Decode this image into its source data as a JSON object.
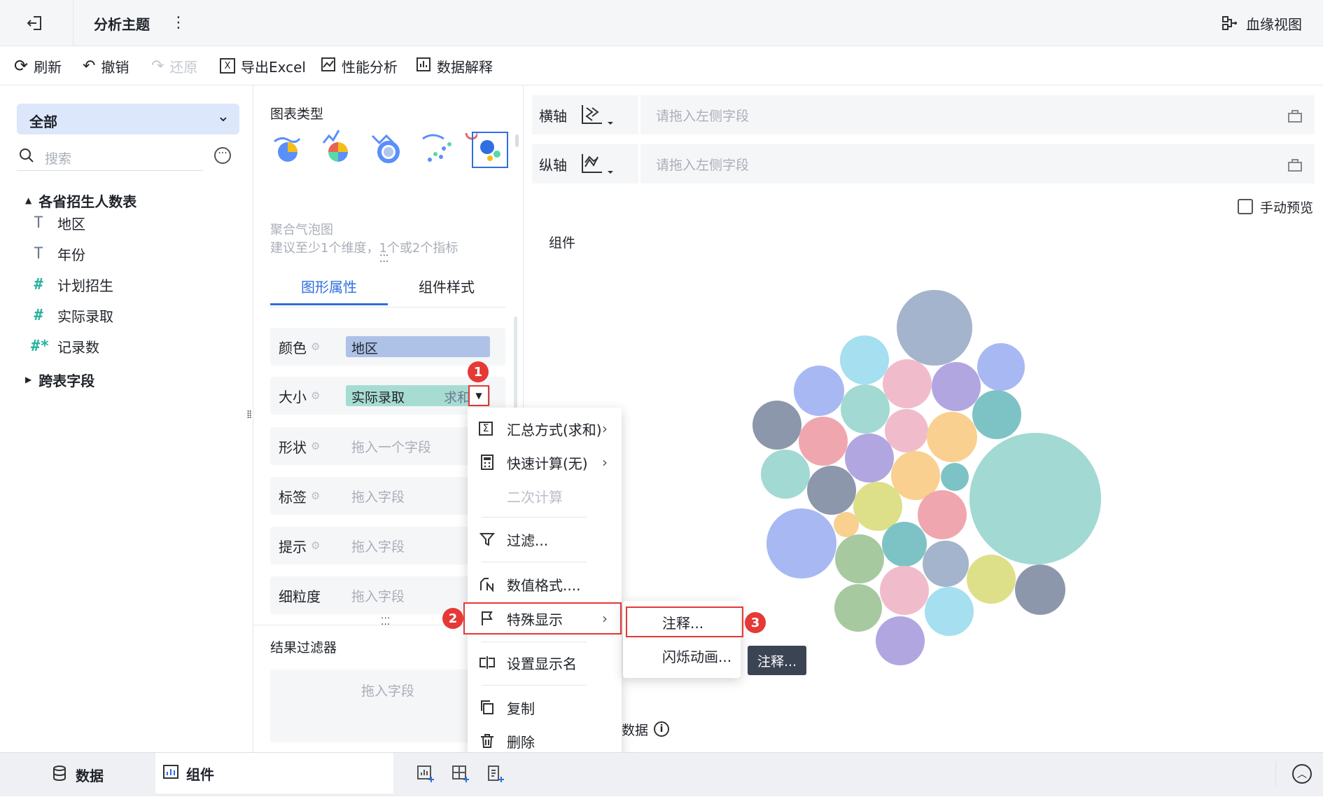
{
  "header": {
    "title": "分析主题",
    "lineage_label": "血缘视图"
  },
  "toolbar": {
    "refresh": "刷新",
    "undo": "撤销",
    "redo": "还原",
    "export_excel": "导出Excel",
    "performance": "性能分析",
    "data_explain": "数据解释"
  },
  "left": {
    "scope_select": "全部",
    "search_placeholder": "搜索",
    "table_name": "各省招生人数表",
    "fields": [
      {
        "label": "地区",
        "type": "text"
      },
      {
        "label": "年份",
        "type": "text"
      },
      {
        "label": "计划招生",
        "type": "number"
      },
      {
        "label": "实际录取",
        "type": "number"
      },
      {
        "label": "记录数",
        "type": "number-star"
      }
    ],
    "cross_table": "跨表字段"
  },
  "middle": {
    "chart_type_title": "图表类型",
    "chart_name": "聚合气泡图",
    "chart_hint": "建议至少1个维度，1个或2个指标",
    "tabs": [
      "图形属性",
      "组件样式"
    ],
    "props": {
      "color_label": "颜色",
      "color_field": "地区",
      "size_label": "大小",
      "size_field": "实际录取",
      "size_agg": "求和",
      "shape_label": "形状",
      "shape_placeholder": "拖入一个字段",
      "tag_label": "标签",
      "tag_placeholder": "拖入字段",
      "tip_label": "提示",
      "tip_placeholder": "拖入字段",
      "grain_label": "细粒度",
      "grain_placeholder": "拖入字段"
    },
    "result_filter": "结果过滤器",
    "result_filter_placeholder": "拖入字段"
  },
  "right": {
    "x_axis": "横轴",
    "y_axis": "纵轴",
    "axis_placeholder": "请拖入左侧字段",
    "manual_preview": "手动预览",
    "component_label": "组件",
    "data_label_partial": "数据"
  },
  "context_menu": {
    "items": [
      "汇总方式(求和)",
      "快速计算(无)",
      "二次计算",
      "过滤...",
      "数值格式....",
      "特殊显示",
      "设置显示名",
      "复制",
      "删除"
    ]
  },
  "submenu": {
    "items": [
      "注释...",
      "闪烁动画..."
    ]
  },
  "tooltip": "注释...",
  "badges": [
    "1",
    "2",
    "3"
  ],
  "bottom": {
    "data_tab": "数据",
    "component_tab": "组件"
  },
  "bubble_colors": [
    "#a3b4cc",
    "#a5dff0",
    "#f0bccb",
    "#b2a6e0",
    "#a8b8f3",
    "#a2d9d3",
    "#f9d090",
    "#7dc3c6",
    "#8d97ab",
    "#a7c9a0",
    "#dde089",
    "#f0a6ae"
  ]
}
